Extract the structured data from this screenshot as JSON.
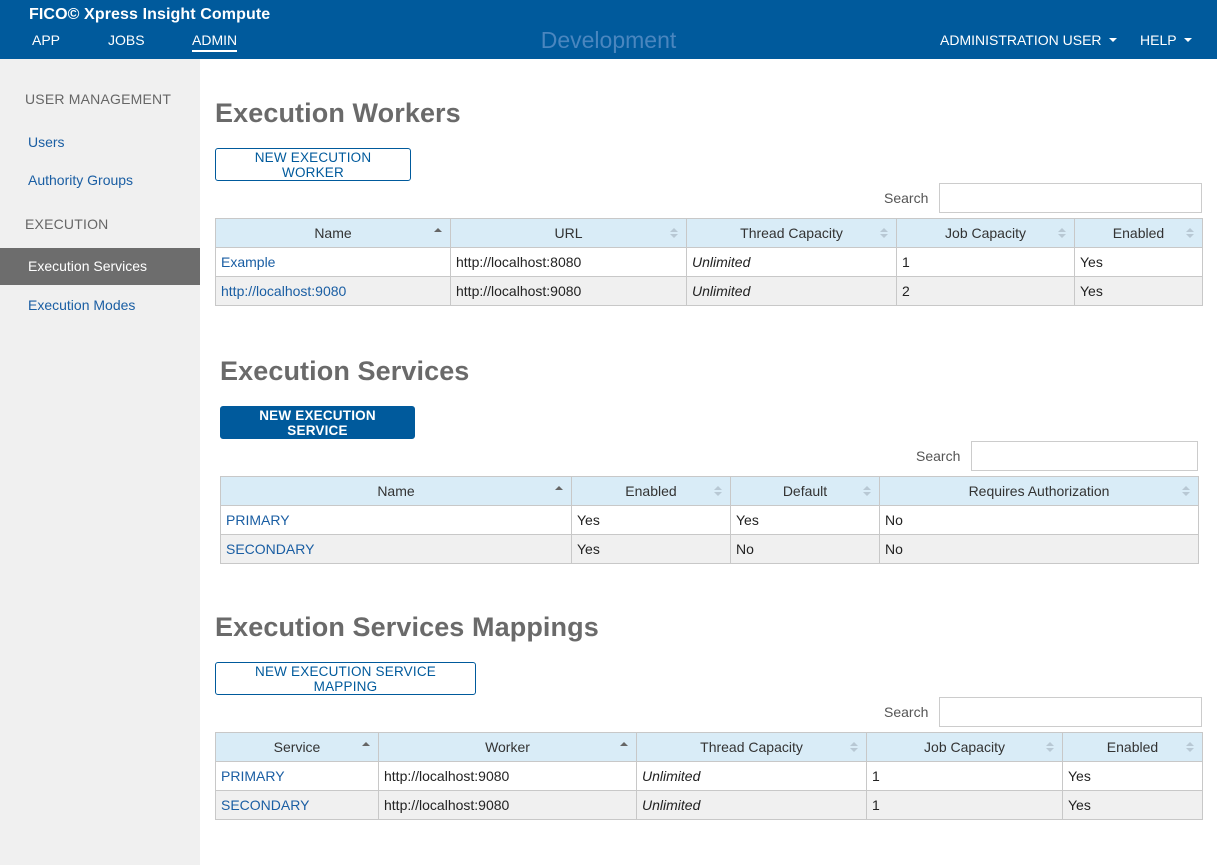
{
  "header": {
    "brand": "FICO© Xpress Insight Compute",
    "nav": [
      "APP",
      "JOBS",
      "ADMIN"
    ],
    "environment": "Development",
    "user_menu": "ADMINISTRATION USER",
    "help_menu": "HELP"
  },
  "sidebar": {
    "user_management": "USER MANAGEMENT",
    "users": "Users",
    "authority_groups": "Authority Groups",
    "execution": "EXECUTION",
    "execution_services": "Execution Services",
    "execution_modes": "Execution Modes"
  },
  "workers": {
    "title": "Execution Workers",
    "new_button": "NEW EXECUTION WORKER",
    "search_label": "Search",
    "columns": [
      "Name",
      "URL",
      "Thread Capacity",
      "Job Capacity",
      "Enabled"
    ],
    "rows": [
      [
        "Example",
        "http://localhost:8080",
        "Unlimited",
        "1",
        "Yes"
      ],
      [
        "http://localhost:9080",
        "http://localhost:9080",
        "Unlimited",
        "2",
        "Yes"
      ]
    ]
  },
  "services": {
    "title": "Execution Services",
    "new_button": "NEW EXECUTION SERVICE",
    "search_label": "Search",
    "columns": [
      "Name",
      "Enabled",
      "Default",
      "Requires Authorization"
    ],
    "rows": [
      [
        "PRIMARY",
        "Yes",
        "Yes",
        "No"
      ],
      [
        "SECONDARY",
        "Yes",
        "No",
        "No"
      ]
    ]
  },
  "mappings": {
    "title": "Execution Services Mappings",
    "new_button": "NEW EXECUTION SERVICE MAPPING",
    "search_label": "Search",
    "columns": [
      "Service",
      "Worker",
      "Thread Capacity",
      "Job Capacity",
      "Enabled"
    ],
    "rows": [
      [
        "PRIMARY",
        "http://localhost:9080",
        "Unlimited",
        "1",
        "Yes"
      ],
      [
        "SECONDARY",
        "http://localhost:9080",
        "Unlimited",
        "1",
        "Yes"
      ]
    ]
  },
  "colors": {
    "header_bg": "#005a9c",
    "link": "#1a5ea3",
    "sidebar_bg": "#f0f0f0",
    "sidebar_active": "#6d6d6d",
    "table_header": "#d9ecf7"
  }
}
